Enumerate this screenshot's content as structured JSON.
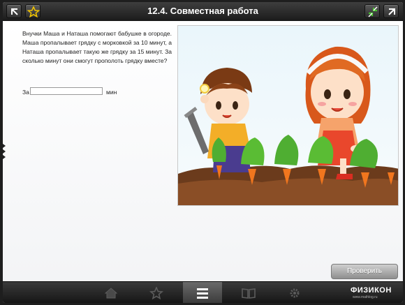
{
  "header": {
    "title": "12.4. Совместная работа",
    "back_icon": "back-arrow-icon",
    "favorite_icon": "star-icon",
    "fullscreen_icon": "fullscreen-toggle-icon",
    "forward_icon": "forward-arrow-icon"
  },
  "problem": {
    "text": "Внучки Маша и Наташа помогают бабушке в огороде. Маша пропалывает грядку с морковкой за 10 минут, а Наташа пропалывает такую же грядку за 15 минут. За сколько минут они смогут прополоть грядку вместе?"
  },
  "answer": {
    "prefix": "За",
    "value": "",
    "unit": "мин"
  },
  "check_button": {
    "label": "Проверить"
  },
  "toolbar": {
    "items": [
      "home-icon",
      "star-icon",
      "menu-icon",
      "book-icon",
      "settings-icon"
    ],
    "active": "menu-icon"
  },
  "logo": {
    "brand": "ФИЗИКОН",
    "site": "www.mathlog.ru"
  },
  "colors": {
    "header": "#2a2a2a",
    "accent_green": "#3fae2a",
    "button": "#a8a8a8"
  }
}
